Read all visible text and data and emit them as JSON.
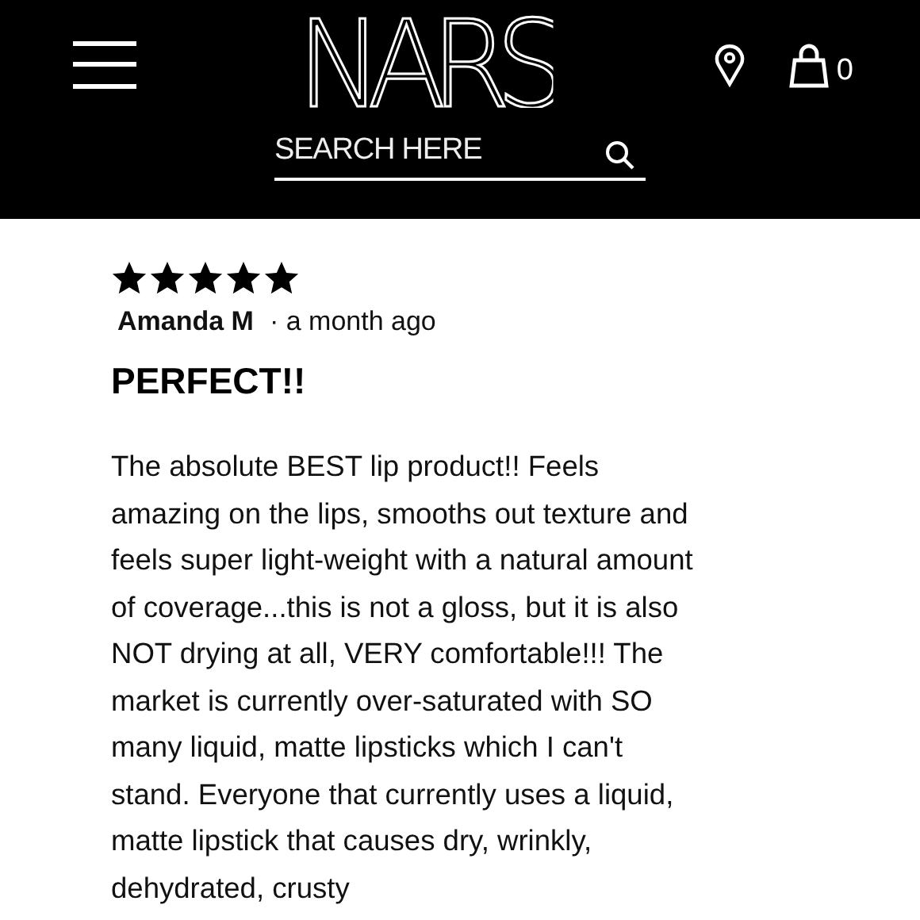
{
  "header": {
    "logo": "NARS",
    "search": {
      "placeholder": "SEARCH HERE"
    },
    "cart_count": "0"
  },
  "review": {
    "stars": 5,
    "author": "Amanda M",
    "time": "· a month ago",
    "title": "PERFECT!!",
    "body": "The absolute BEST lip product!! Feels amazing on the lips, smooths out texture and feels super light-weight with a natural amount of coverage...this is not a gloss, but it is also NOT drying at all, VERY comfortable!!! The market is currently over-saturated with SO many liquid, matte lipsticks which I can't stand. Everyone that currently uses a liquid, matte lipstick that causes dry, wrinkly, dehydrated, crusty"
  }
}
